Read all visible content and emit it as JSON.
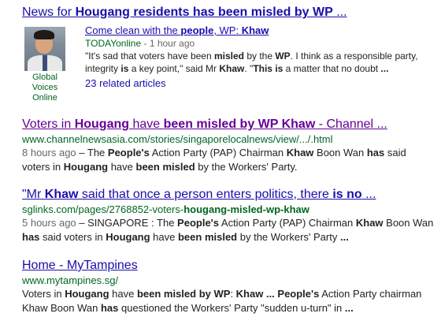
{
  "results": [
    {
      "title_a": "News for ",
      "title_b": "Hougang residents has been misled by WP",
      "title_c": " ...",
      "news": {
        "thumb_caption": "Global Voices Online",
        "headline_a": "Come clean with the ",
        "headline_b": "people",
        "headline_c": ", WP: ",
        "headline_d": "Khaw",
        "source": "TODAYonline",
        "time": " - 1 hour ago",
        "snippet": [
          {
            "t": "\"It's sad that voters have been ",
            "b": false
          },
          {
            "t": "misled",
            "b": true
          },
          {
            "t": " by the ",
            "b": false
          },
          {
            "t": "WP",
            "b": true
          },
          {
            "t": ". I think as a responsible party, integrity ",
            "b": false
          },
          {
            "t": "is",
            "b": true
          },
          {
            "t": " a key point,\" said Mr ",
            "b": false
          },
          {
            "t": "Khaw",
            "b": true
          },
          {
            "t": ". \"",
            "b": false
          },
          {
            "t": "This",
            "b": true
          },
          {
            "t": " ",
            "b": false
          },
          {
            "t": "is",
            "b": true
          },
          {
            "t": " a matter that no doubt ",
            "b": false
          },
          {
            "t": "...",
            "b": true
          }
        ],
        "related": "23 related articles"
      }
    },
    {
      "title": [
        {
          "t": "Voters in ",
          "b": false
        },
        {
          "t": "Hougang",
          "b": true
        },
        {
          "t": " have ",
          "b": false
        },
        {
          "t": "been misled by WP Khaw",
          "b": true
        },
        {
          "t": " - Channel ...",
          "b": false
        }
      ],
      "url": "www.channelnewsasia.com/stories/singaporelocalnews/view/.../.html",
      "time": "8 hours ago",
      "snippet": [
        {
          "t": " – The ",
          "b": false
        },
        {
          "t": "People's",
          "b": true
        },
        {
          "t": " Action Party (PAP) Chairman ",
          "b": false
        },
        {
          "t": "Khaw",
          "b": true
        },
        {
          "t": " Boon Wan ",
          "b": false
        },
        {
          "t": "has",
          "b": true
        },
        {
          "t": " said voters in ",
          "b": false
        },
        {
          "t": "Hougang",
          "b": true
        },
        {
          "t": " have ",
          "b": false
        },
        {
          "t": "been misled",
          "b": true
        },
        {
          "t": " by the Workers' Party.",
          "b": false
        }
      ]
    },
    {
      "title": [
        {
          "t": "\"Mr ",
          "b": false
        },
        {
          "t": "Khaw",
          "b": true
        },
        {
          "t": " said that once a person enters politics, there ",
          "b": false
        },
        {
          "t": "is no",
          "b": true
        },
        {
          "t": " ...",
          "b": false
        }
      ],
      "url_parts": [
        {
          "t": "sglinks.com/pages/2768852-voters-",
          "b": false
        },
        {
          "t": "hougang-misled-wp-khaw",
          "b": true
        }
      ],
      "time": "5 hours ago",
      "snippet": [
        {
          "t": " – SINGAPORE : The ",
          "b": false
        },
        {
          "t": "People's",
          "b": true
        },
        {
          "t": " Action Party (PAP) Chairman ",
          "b": false
        },
        {
          "t": "Khaw",
          "b": true
        },
        {
          "t": " Boon Wan ",
          "b": false
        },
        {
          "t": "has",
          "b": true
        },
        {
          "t": " said voters in ",
          "b": false
        },
        {
          "t": "Hougang",
          "b": true
        },
        {
          "t": " have ",
          "b": false
        },
        {
          "t": "been misled",
          "b": true
        },
        {
          "t": " by the Workers' Party ",
          "b": false
        },
        {
          "t": "...",
          "b": true
        }
      ]
    },
    {
      "title": [
        {
          "t": "Home - MyTampines",
          "b": false
        }
      ],
      "url": "www.mytampines.sg/",
      "snippet": [
        {
          "t": "Voters in ",
          "b": false
        },
        {
          "t": "Hougang",
          "b": true
        },
        {
          "t": " have ",
          "b": false
        },
        {
          "t": "been misled by WP",
          "b": true
        },
        {
          "t": ": ",
          "b": false
        },
        {
          "t": "Khaw ... People's",
          "b": true
        },
        {
          "t": " Action Party chairman Khaw Boon Wan ",
          "b": false
        },
        {
          "t": "has",
          "b": true
        },
        {
          "t": " questioned the Workers' Party \"sudden u-turn\" in ",
          "b": false
        },
        {
          "t": "...",
          "b": true
        }
      ]
    }
  ]
}
